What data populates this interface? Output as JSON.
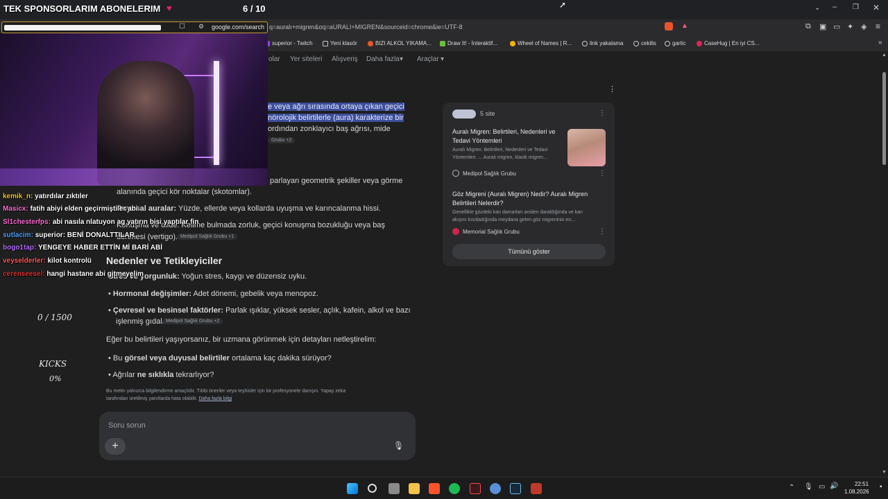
{
  "overlay": {
    "title": "TEK SPONSORLARIM ABONELERIM",
    "counter": "6 / 10",
    "goal": "0 / 1500",
    "kicks_label": "KICKS",
    "kicks_value": "0%"
  },
  "browser": {
    "url_domain": "google.com/search",
    "url_rest": "q=auralı+migren&oq=aURALI+MIGREN&sourceid=chrome&ie=UTF-8",
    "bookmarks": [
      "superior - Twitch",
      "Yeni klasör",
      "BIZI ALKOL YIKAMA...",
      "Draw It! - İnteraktif...",
      "Wheel of Names | R...",
      "link yakalama",
      "cekilis",
      "gartic",
      "CaseHug | En iyi CS..."
    ]
  },
  "search_nav": {
    "tabs": [
      "olar",
      "Yer siteleri",
      "Alışveriş",
      "Daha fazla",
      "Araçlar"
    ]
  },
  "ai_overview": {
    "line1": "e veya ağrı sırasında ortaya çıkan geçici",
    "line2": "nörolojik belirtilerle (aura) karakterize bir",
    "line3": "ordından zonklayıcı baş ağrısı, mide",
    "chip1": "Grubu +2",
    "visual_line": "parlayan geometrik şekiller veya görme",
    "visual_line2": "alanında geçici kör noktalar (skotomlar).",
    "sensory_label": "Duyusal auralar:",
    "sensory_text": " Yüzde, ellerde veya kollarda uyuşma ve karıncalanma hissi.",
    "speech_line": "Konuşma ve dilde: Kelime bulmada zorluk, geçici konuşma bozukluğu veya baş",
    "speech_line2": "dönmesi (vertigo).",
    "chip2": "Medipol Sağlık Grubu +1",
    "heading": "Nedenler ve Tetikleyiciler",
    "stress_label": "Stres ve yorgunluk:",
    "stress_text": " Yoğun stres, kaygı ve düzensiz uyku.",
    "hormone_label": "Hormonal değişimler:",
    "hormone_text": " Adet dönemi, gebelik veya menopoz.",
    "env_label": "Çevresel ve besinsel faktörler:",
    "env_text": " Parlak ışıklar, yüksek sesler, açlık, kafein, alkol ve bazı",
    "env_text2": "işlenmiş gıdalar.",
    "chip3": "Medipol Sağlık Grubu +2",
    "prompt": "Eğer bu belirtileri yaşıyorsanız, bir uzmana görünmek için detayları netleştirelim:",
    "q1_pre": "Bu ",
    "q1_bold": "görsel veya duyusal belirtiler",
    "q1_post": " ortalama kaç dakika sürüyor?",
    "q2_pre": "Ağrılar ",
    "q2_bold": "ne sıklıkla",
    "q2_post": " tekrarlıyor?",
    "disclaimer1": "Bu metin yalnızca bilgilendirme amaçlıdır. Tıbbi öneriler veya teşhisler için bir profesyonele danışın. Yapay zeka",
    "disclaimer2": "tarafından üretilmiş yanıtlarda hata olabilir.",
    "disclaimer_link": "Daha fazla bilgi",
    "ask_placeholder": "Soru sorun"
  },
  "sources": {
    "count": "5 site",
    "item1_title1": "Auralı Migren: Belirtileri, Nedenleri ve",
    "item1_title2": "Tedavi Yöntemleri",
    "item1_snip1": "Auralı Migren: Belirtileri, Nedenleri ve Tedavi",
    "item1_snip2": "Yöntemleri. ... Auralı migren, klasik migren...",
    "item1_source": "Medipol Sağlık Grubu",
    "item2_title1": "Göz Migreni (Auralı Migren) Nedir? Auralı Migren",
    "item2_title2": "Belirtileri Nelerdir?",
    "item2_snip1": "Genellikle gözdeki kan damarları aniden daraldığında ve kan",
    "item2_snip2": "akışını kısıtladığında meydana gelen göz migreninin en...",
    "item2_source": "Memorial Sağlık Grubu",
    "show_all": "Tümünü göster"
  },
  "chat": [
    {
      "user": "kemik_n:",
      "msg": "yatırdılar zıktıler",
      "color": "#f5c518"
    },
    {
      "user": "Masicx:",
      "msg": "fatih abiyi elden geçirmiştiler abi",
      "color": "#ff6ad5"
    },
    {
      "user": "Sl1chesterfps:",
      "msg": "abi nasıla nlatuyon ag yatırın bisi yaptılar fin",
      "color": "#ff6ad5"
    },
    {
      "user": "sutlacim:",
      "msg": "superior: BENİ DONALTTILAR",
      "color": "#4aa3ff"
    },
    {
      "user": "bogo1tap:",
      "msg": "YENGEYE HABER ETTİN Mİ BARİ ABİ",
      "color": "#b46cff"
    },
    {
      "user": "veyselderler:",
      "msg": "kilot kontrolü",
      "color": "#ff5b5b"
    },
    {
      "user": "cerenseesel:",
      "msg": "hangi hastane abi gitmeyelim",
      "color": "#e03030"
    }
  ],
  "taskbar": {
    "time": "22:51",
    "date": "1.08.2026"
  },
  "colors": {
    "highlight": "#3d4f9a",
    "page_bg": "#1f1f1f",
    "card_bg": "#2a2a2c"
  }
}
